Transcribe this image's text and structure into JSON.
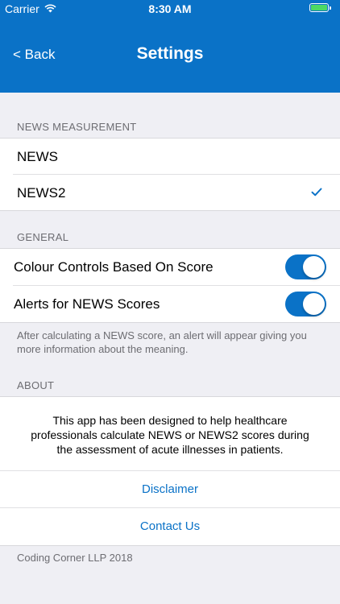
{
  "status_bar": {
    "carrier": "Carrier",
    "time": "8:30 AM"
  },
  "nav": {
    "back_label": "< Back",
    "title": "Settings"
  },
  "news_measurement": {
    "header": "NEWS MEASUREMENT",
    "options": [
      {
        "label": "NEWS",
        "selected": false
      },
      {
        "label": "NEWS2",
        "selected": true
      }
    ]
  },
  "general": {
    "header": "GENERAL",
    "toggles": [
      {
        "label": "Colour Controls Based On Score",
        "on": true
      },
      {
        "label": "Alerts for NEWS Scores",
        "on": true
      }
    ],
    "footer": "After calculating a NEWS score, an alert will appear giving you more information about the meaning."
  },
  "about": {
    "header": "ABOUT",
    "description": "This app has been designed to help healthcare professionals calculate NEWS or NEWS2 scores during the assessment of acute illnesses in patients.",
    "links": [
      "Disclaimer",
      "Contact Us"
    ],
    "footer": "Coding Corner LLP 2018"
  },
  "colors": {
    "accent": "#0a72c7",
    "background": "#efeff4"
  }
}
